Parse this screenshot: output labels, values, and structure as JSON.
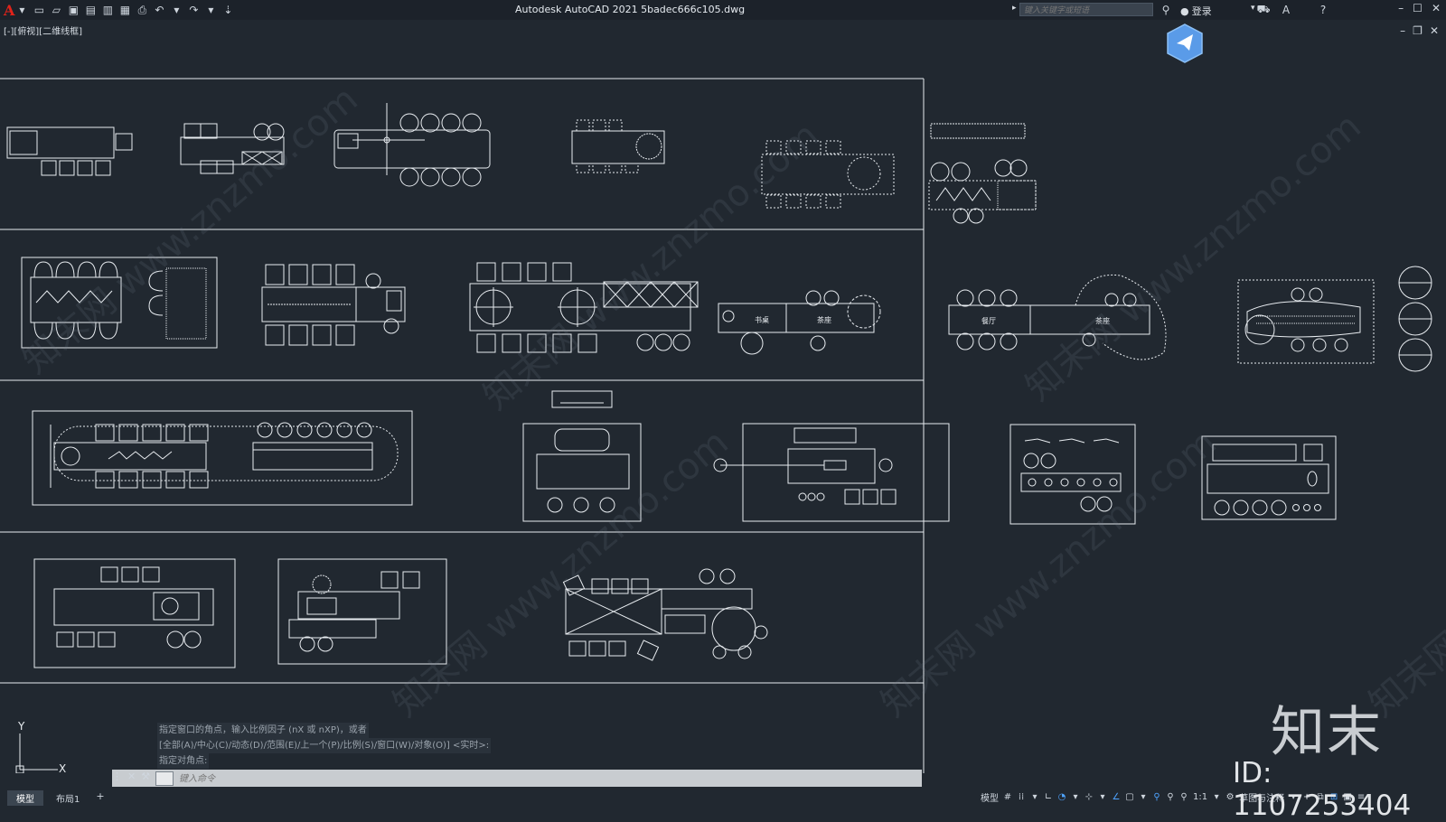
{
  "titlebar": {
    "title": "Autodesk AutoCAD 2021    5badec666c105.dwg",
    "search_placeholder": "键入关键字或短语",
    "login_label": "登录"
  },
  "viewport_label": "[-][俯视][二维线框]",
  "drawing_labels": {
    "study": "书桌",
    "tea": "茶座",
    "dining": "餐厅",
    "tea2": "茶座"
  },
  "command": {
    "history": [
      "指定窗口的角点，输入比例因子 (nX 或 nXP)，或者",
      "[全部(A)/中心(C)/动态(D)/范围(E)/上一个(P)/比例(S)/窗口(W)/对象(O)] <实时>:",
      "指定对角点:"
    ],
    "input_placeholder": "键入命令"
  },
  "tabs": {
    "model": "模型",
    "layout1": "布局1",
    "add": "+"
  },
  "statusbar": {
    "model_label": "模型",
    "scale": "1:1",
    "workspace": "草图与注释"
  },
  "ucs": {
    "x": "X",
    "y": "Y"
  },
  "brand": {
    "name": "知末",
    "id": "ID: 1107253404"
  },
  "watermark_text": "知末网 www.znzmo.com",
  "colors": {
    "background": "#212830",
    "lines": "#e8ecf0",
    "accent": "#4ea3ff",
    "logo": "#e2231a"
  }
}
